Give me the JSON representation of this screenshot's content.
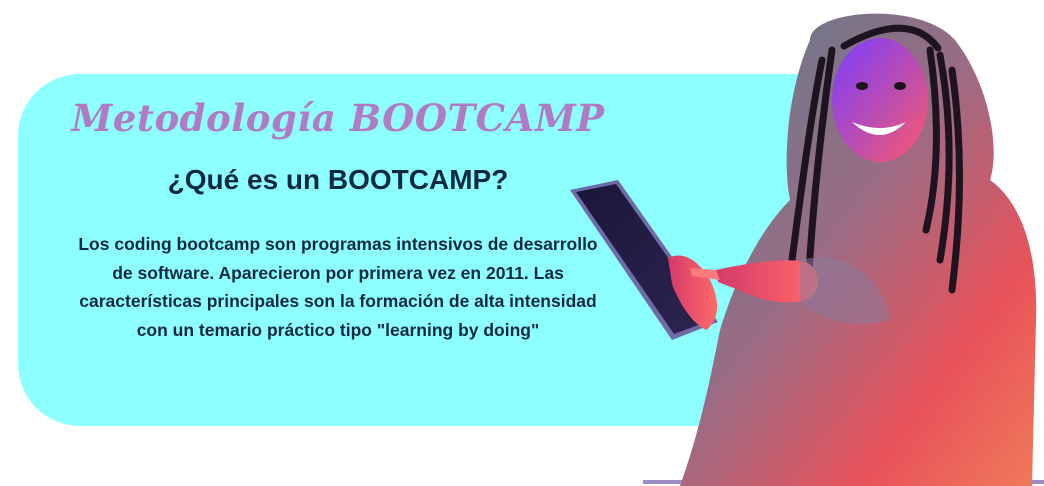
{
  "section": {
    "kicker": "Metodología BOOTCAMP",
    "headline": "¿Qué es un BOOTCAMP?",
    "body": "Los coding bootcamp son programas intensivos de desarrollo de software. Aparecieron por primera vez en 2011. Las características principales son la formación de alta intensidad con un temario práctico tipo \"learning by doing\""
  },
  "colors": {
    "card_background": "#8effff",
    "kicker": "#b07bc4",
    "text": "#0f2944",
    "bottom_rule": "#9b8dc4"
  },
  "image": {
    "subject": "smiling-person-holding-tablet-photo"
  }
}
